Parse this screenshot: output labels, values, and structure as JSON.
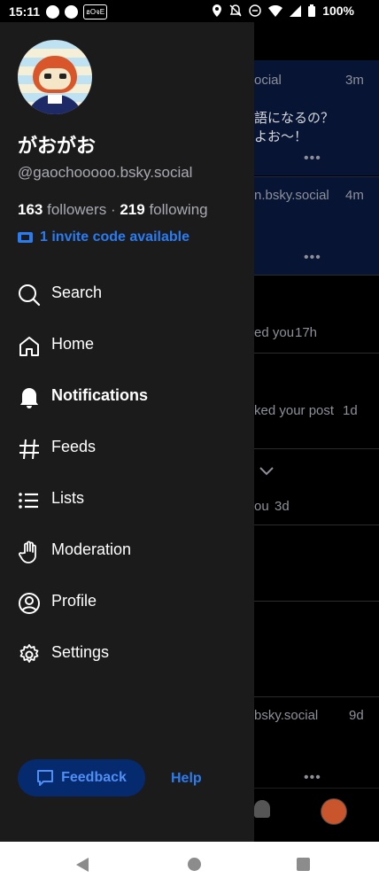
{
  "status_bar": {
    "time": "15:11",
    "battery": "100%",
    "tag": "ฮOจE"
  },
  "profile": {
    "display_name": "がおがお",
    "handle": "@gaochooooo.bsky.social",
    "followers_count": "163",
    "followers_label": "followers",
    "separator": "·",
    "following_count": "219",
    "following_label": "following",
    "invite": "1 invite code available"
  },
  "menu": [
    {
      "label": "Search",
      "icon": "search-icon"
    },
    {
      "label": "Home",
      "icon": "home-icon"
    },
    {
      "label": "Notifications",
      "icon": "bell-icon"
    },
    {
      "label": "Feeds",
      "icon": "hash-icon"
    },
    {
      "label": "Lists",
      "icon": "list-icon"
    },
    {
      "label": "Moderation",
      "icon": "hand-icon"
    },
    {
      "label": "Profile",
      "icon": "user-circle-icon"
    },
    {
      "label": "Settings",
      "icon": "gear-icon"
    }
  ],
  "footer": {
    "feedback": "Feedback",
    "help": "Help"
  },
  "feed": {
    "item1_handle": "ocial",
    "item1_time": "3m",
    "item1_line1": "語になるの？",
    "item1_line2": "よお～！",
    "item2_handle": "n.bsky.social",
    "item2_time": "4m",
    "n1": "ed you",
    "n1_time": "17h",
    "n2": "ked your post",
    "n2_time": "1d",
    "n3": "ou",
    "n3_time": "3d",
    "item3_handle": "bsky.social",
    "item3_time": "9d",
    "more": "•••"
  },
  "colors": {
    "accent": "#2b7cf0",
    "drawer_bg": "#1c1b1c",
    "highlight": "#071433"
  }
}
